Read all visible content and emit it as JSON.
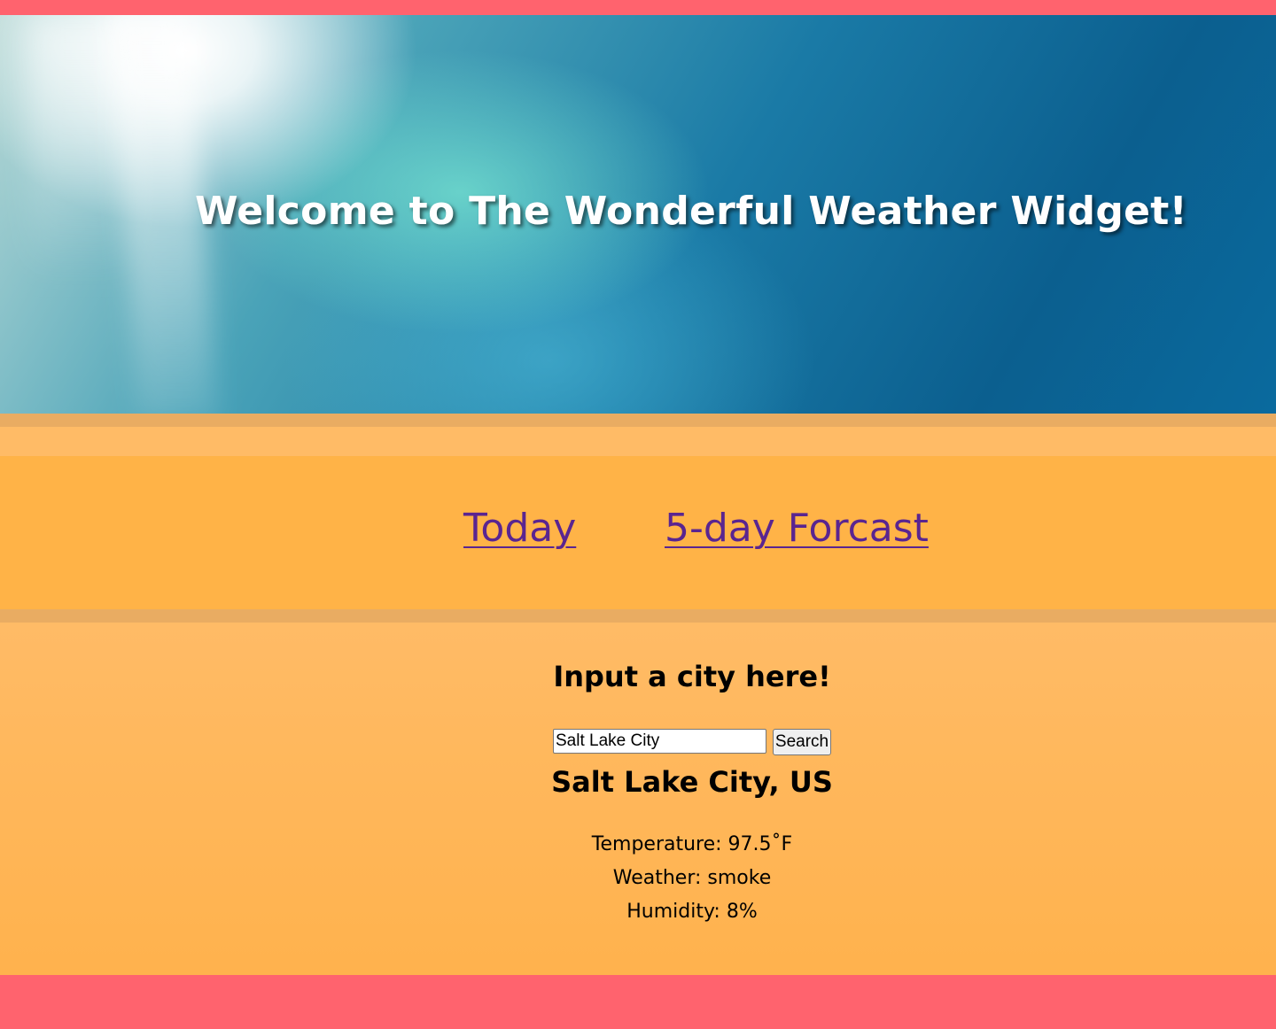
{
  "header": {
    "title": "Welcome to The Wonderful Weather Widget!"
  },
  "nav": {
    "today_label": "Today",
    "forecast_label": "5-day Forcast"
  },
  "search": {
    "prompt": "Input a city here!",
    "input_value": "Salt Lake City",
    "button_label": "Search"
  },
  "result": {
    "city": "Salt Lake City, US",
    "temperature": "Temperature: 97.5˚F",
    "weather": "Weather: smoke",
    "humidity": "Humidity: 8%"
  },
  "colors": {
    "accent_red": "#ff636e",
    "nav_orange": "#ffb347",
    "band_orange": "#e9ac62",
    "link_purple": "#5a2590"
  }
}
